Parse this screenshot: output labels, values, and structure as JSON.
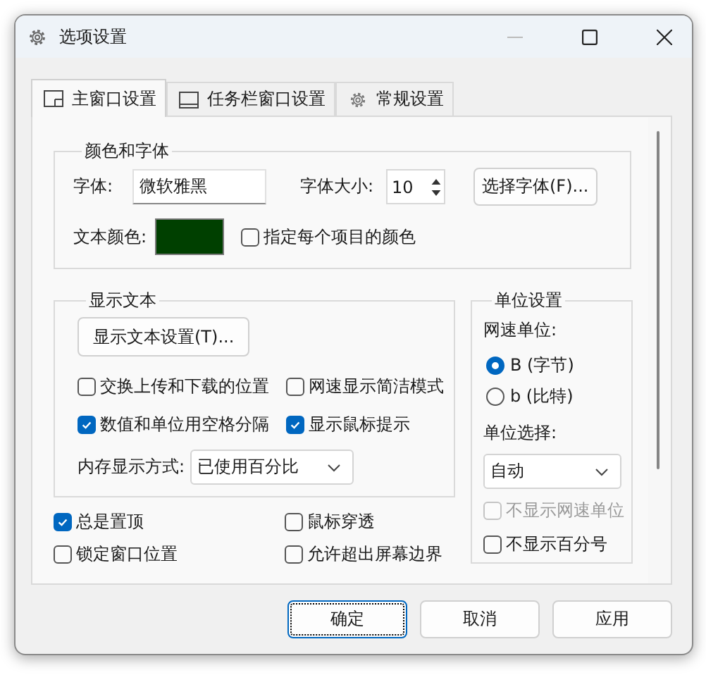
{
  "window": {
    "title": "选项设置"
  },
  "tabs": [
    {
      "label": "主窗口设置",
      "selected": true
    },
    {
      "label": "任务栏窗口设置",
      "selected": false
    },
    {
      "label": "常规设置",
      "selected": false
    }
  ],
  "color_font": {
    "title": "颜色和字体",
    "font_label": "字体:",
    "font_value": "微软雅黑",
    "size_label": "字体大小:",
    "size_value": "10",
    "choose_button": "选择字体(F)...",
    "text_color_label": "文本颜色:",
    "swatch": {
      "color": "#004000"
    },
    "per_item": {
      "label": "指定每个项目的颜色",
      "checked": false
    }
  },
  "display_text": {
    "title": "显示文本",
    "settings_button": "显示文本设置(T)...",
    "options": [
      {
        "label": "交换上传和下载的位置",
        "checked": false
      },
      {
        "label": "网速显示简洁模式",
        "checked": false
      },
      {
        "label": "数值和单位用空格分隔",
        "checked": true
      },
      {
        "label": "显示鼠标提示",
        "checked": true
      }
    ],
    "memory_label": "内存显示方式:",
    "memory_value": "已使用百分比"
  },
  "units": {
    "title": "单位设置",
    "speed_unit_label": "网速单位:",
    "radios": [
      {
        "label": "B (字节)",
        "selected": true
      },
      {
        "label": "b (比特)",
        "selected": false
      }
    ],
    "unit_choice_label": "单位选择:",
    "unit_choice_value": "自动",
    "hide_speed_unit": {
      "label": "不显示网速单位",
      "checked": false,
      "disabled": true
    },
    "hide_percent": {
      "label": "不显示百分号",
      "checked": false,
      "disabled": false
    }
  },
  "general_options": [
    {
      "label": "总是置顶",
      "checked": true
    },
    {
      "label": "鼠标穿透",
      "checked": false
    },
    {
      "label": "锁定窗口位置",
      "checked": false
    },
    {
      "label": "允许超出屏幕边界",
      "checked": false
    }
  ],
  "buttons": [
    {
      "label": "确定",
      "focused": true
    },
    {
      "label": "取消",
      "focused": false
    },
    {
      "label": "应用",
      "focused": false
    }
  ]
}
